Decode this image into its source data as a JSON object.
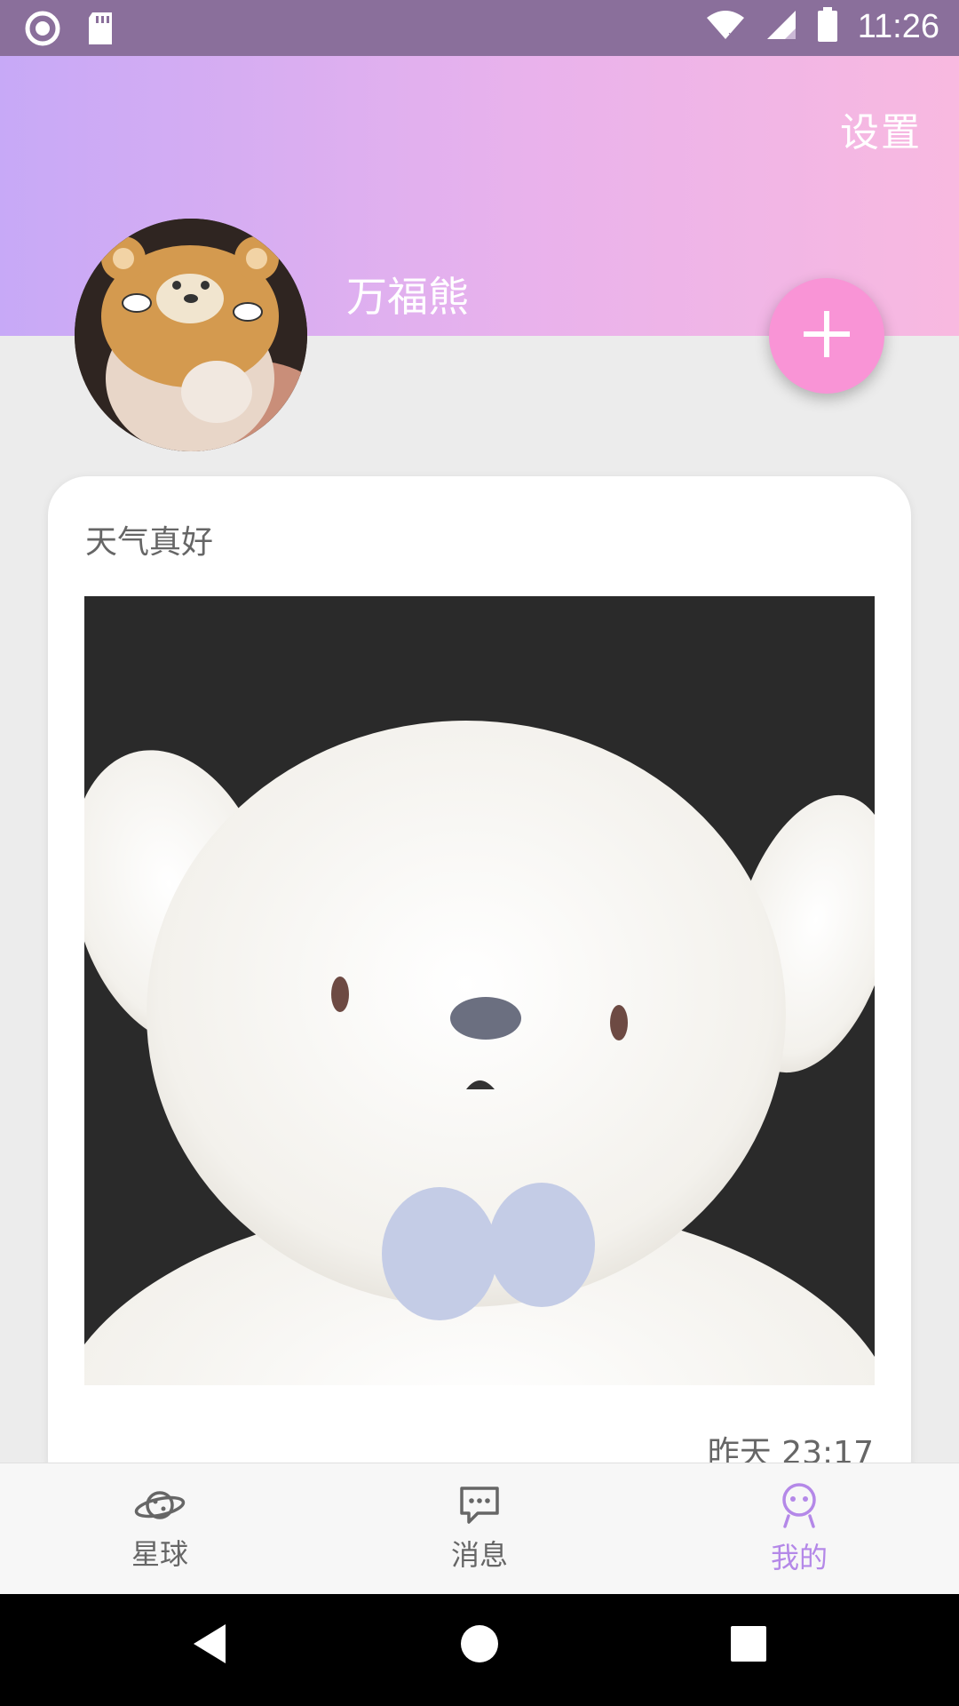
{
  "status_bar": {
    "time": "11:26"
  },
  "header": {
    "settings_label": "设置",
    "username": "万福熊"
  },
  "post": {
    "text": "天气真好",
    "timestamp": "昨天 23:17"
  },
  "bottom_nav": [
    {
      "label": "星球",
      "icon": "planet-icon",
      "active": false
    },
    {
      "label": "消息",
      "icon": "message-icon",
      "active": false
    },
    {
      "label": "我的",
      "icon": "profile-icon",
      "active": true
    }
  ],
  "colors": {
    "accent": "#b488e8",
    "fab": "#f994d6",
    "header_start": "#c7a9f7",
    "header_end": "#f8b9e0"
  }
}
